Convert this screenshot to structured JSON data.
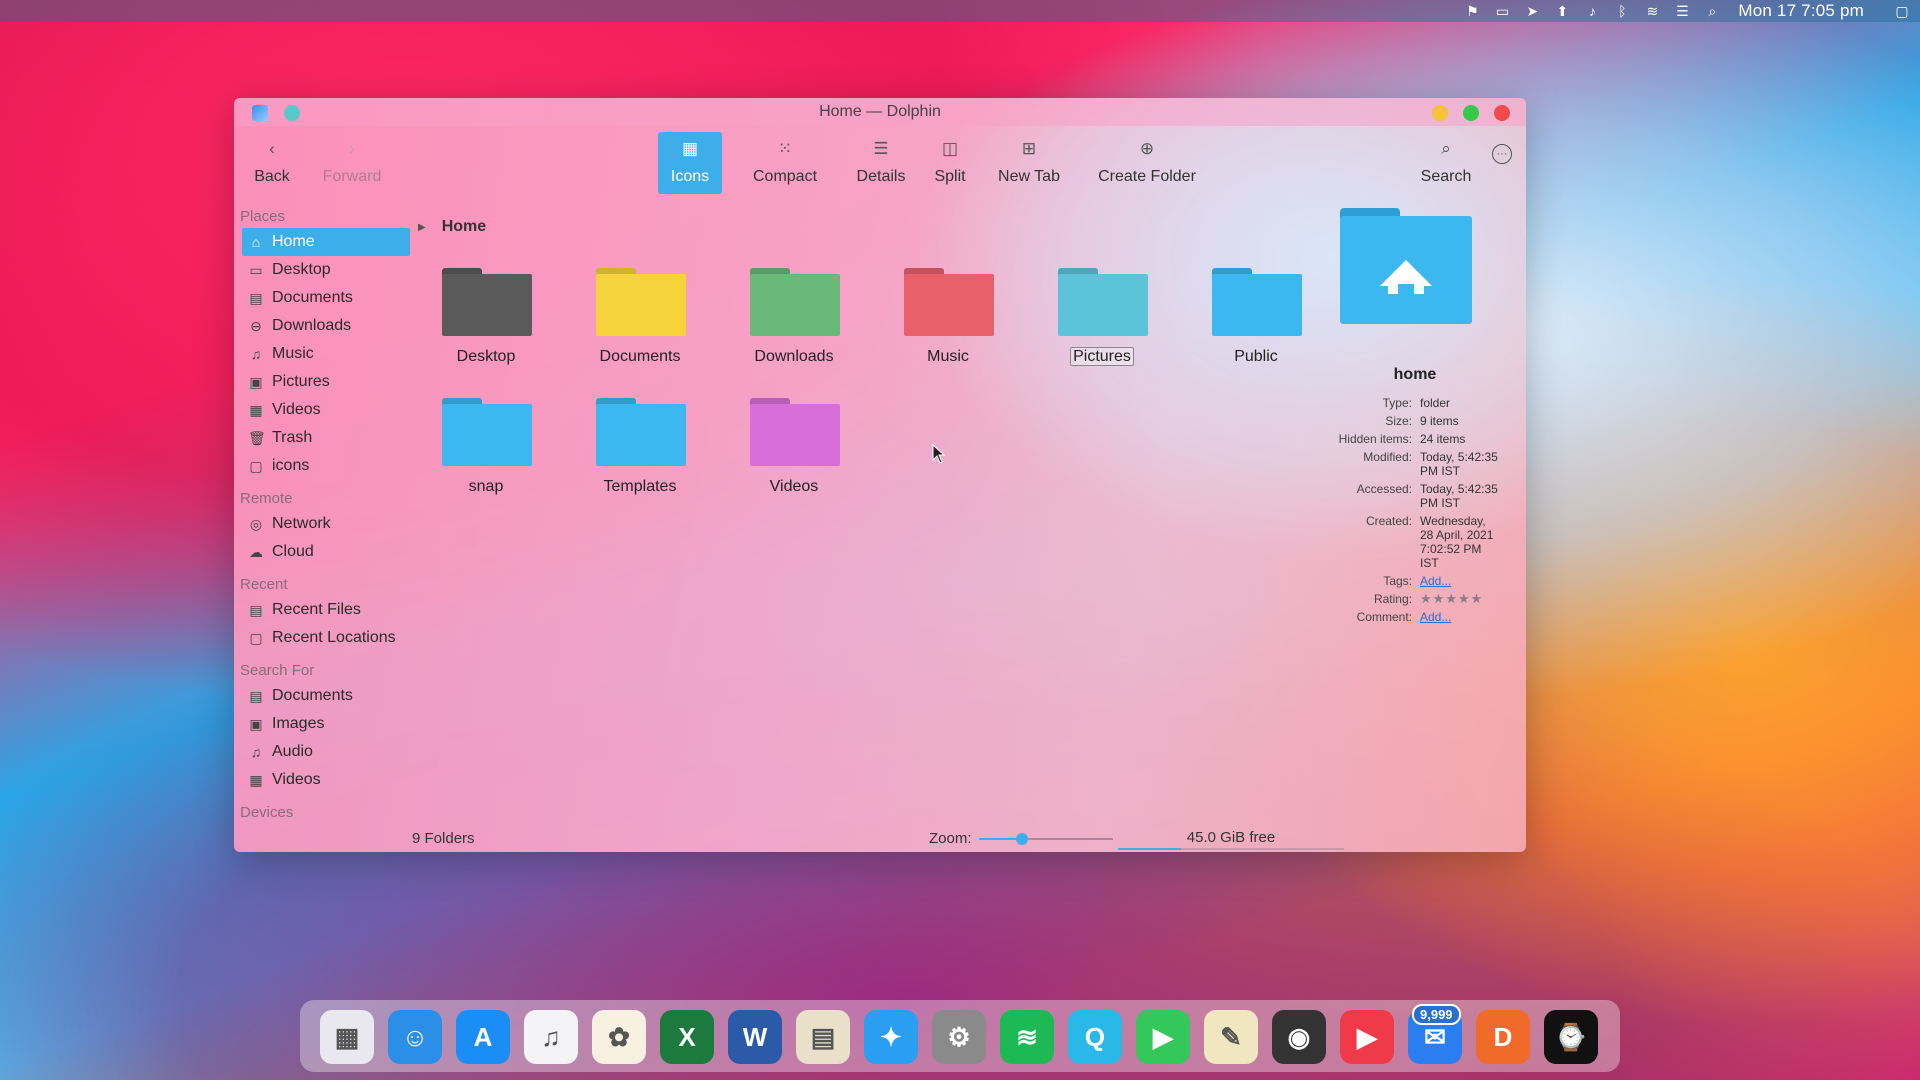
{
  "menubar": {
    "clock": "Mon 17  7:05 pm",
    "tray_icons": [
      "translate-icon",
      "battery-icon",
      "telegram-icon",
      "upload-icon",
      "volume-icon",
      "bluetooth-icon",
      "wifi-icon",
      "toggle-icon",
      "search-icon",
      "display-icon"
    ]
  },
  "window": {
    "title": "Home — Dolphin"
  },
  "toolbar": {
    "back": "Back",
    "forward": "Forward",
    "icons": "Icons",
    "compact": "Compact",
    "details": "Details",
    "split": "Split",
    "new_tab": "New Tab",
    "create_folder": "Create Folder",
    "search": "Search"
  },
  "sidebar": {
    "places_label": "Places",
    "places": [
      {
        "label": "Home",
        "icon": "home-icon"
      },
      {
        "label": "Desktop",
        "icon": "desktop-icon"
      },
      {
        "label": "Documents",
        "icon": "documents-icon"
      },
      {
        "label": "Downloads",
        "icon": "downloads-icon"
      },
      {
        "label": "Music",
        "icon": "music-icon"
      },
      {
        "label": "Pictures",
        "icon": "pictures-icon"
      },
      {
        "label": "Videos",
        "icon": "videos-icon"
      },
      {
        "label": "Trash",
        "icon": "trash-icon"
      },
      {
        "label": "icons",
        "icon": "folder-icon"
      }
    ],
    "remote_label": "Remote",
    "remote": [
      {
        "label": "Network",
        "icon": "network-icon"
      },
      {
        "label": "Cloud",
        "icon": "cloud-icon"
      }
    ],
    "recent_label": "Recent",
    "recent": [
      {
        "label": "Recent Files",
        "icon": "recent-files-icon"
      },
      {
        "label": "Recent Locations",
        "icon": "recent-locations-icon"
      }
    ],
    "search_label": "Search For",
    "search": [
      {
        "label": "Documents",
        "icon": "documents-icon"
      },
      {
        "label": "Images",
        "icon": "images-icon"
      },
      {
        "label": "Audio",
        "icon": "audio-icon"
      },
      {
        "label": "Videos",
        "icon": "videos-icon"
      }
    ],
    "devices_label": "Devices"
  },
  "breadcrumb": {
    "current": "Home"
  },
  "files": [
    {
      "name": "Desktop",
      "icon": "desktop-folder-icon",
      "color": "#5a5a5a"
    },
    {
      "name": "Documents",
      "icon": "documents-folder-icon",
      "color": "#f6d33a"
    },
    {
      "name": "Downloads",
      "icon": "downloads-folder-icon",
      "color": "#6ab87a"
    },
    {
      "name": "Music",
      "icon": "music-folder-icon",
      "color": "#e8606a"
    },
    {
      "name": "Pictures",
      "icon": "pictures-folder-icon",
      "color": "#5cc3d8"
    },
    {
      "name": "Public",
      "icon": "public-folder-icon",
      "color": "#3db7ef"
    },
    {
      "name": "snap",
      "icon": "snap-folder-icon",
      "color": "#3db7ef"
    },
    {
      "name": "Templates",
      "icon": "templates-folder-icon",
      "color": "#3db7ef"
    },
    {
      "name": "Videos",
      "icon": "videos-folder-icon",
      "color": "#d86fd8"
    }
  ],
  "info": {
    "name": "home",
    "rows": [
      {
        "k": "Type:",
        "v": "folder"
      },
      {
        "k": "Size:",
        "v": "9 items"
      },
      {
        "k": "Hidden items:",
        "v": "24 items"
      },
      {
        "k": "Modified:",
        "v": "Today, 5:42:35 PM IST"
      },
      {
        "k": "Accessed:",
        "v": "Today, 5:42:35 PM IST"
      },
      {
        "k": "Created:",
        "v": "Wednesday, 28 April, 2021 7:02:52 PM IST"
      }
    ],
    "tags_label": "Tags:",
    "tags_value": "Add...",
    "rating_label": "Rating:",
    "rating": 0,
    "rating_max": 5,
    "comment_label": "Comment:",
    "comment_value": "Add..."
  },
  "status": {
    "count": "9 Folders",
    "zoom_label": "Zoom:",
    "zoom_fraction": 0.32,
    "free": "45.0 GiB free",
    "used_fraction": 0.28
  },
  "dock": {
    "apps": [
      {
        "name": "launchpad-icon",
        "color": "#e8e8ee",
        "glyph": "▦"
      },
      {
        "name": "finder-icon",
        "color": "#2b8fe8",
        "glyph": "☺"
      },
      {
        "name": "app-store-icon",
        "color": "#1a8ef5",
        "glyph": "A"
      },
      {
        "name": "music-app-icon",
        "color": "#f4f4f6",
        "glyph": "♫"
      },
      {
        "name": "photos-icon",
        "color": "#f8f0e0",
        "glyph": "✿"
      },
      {
        "name": "excel-icon",
        "color": "#1d7a3f",
        "glyph": "X"
      },
      {
        "name": "word-icon",
        "color": "#2a5aa8",
        "glyph": "W"
      },
      {
        "name": "preview-icon",
        "color": "#e8e0c8",
        "glyph": "▤"
      },
      {
        "name": "safari-icon",
        "color": "#2a9ef0",
        "glyph": "✦"
      },
      {
        "name": "system-preferences-icon",
        "color": "#8a8a8a",
        "glyph": "⚙"
      },
      {
        "name": "spotify-icon",
        "color": "#1db954",
        "glyph": "≋"
      },
      {
        "name": "quicktime-icon",
        "color": "#2ab8e8",
        "glyph": "Q"
      },
      {
        "name": "facetime-icon",
        "color": "#34c759",
        "glyph": "▶"
      },
      {
        "name": "textedit-icon",
        "color": "#f0e6c0",
        "glyph": "✎"
      },
      {
        "name": "screenshot-icon",
        "color": "#333333",
        "glyph": "◉"
      },
      {
        "name": "media-player-icon",
        "color": "#f03a4a",
        "glyph": "▶"
      },
      {
        "name": "mail-icon",
        "color": "#2a7ef0",
        "glyph": "✉"
      },
      {
        "name": "dolphin-icon",
        "color": "#f06a2a",
        "glyph": "D"
      },
      {
        "name": "clock-icon",
        "color": "#111111",
        "glyph": "⌚"
      }
    ],
    "mail_badge": "9,999"
  }
}
